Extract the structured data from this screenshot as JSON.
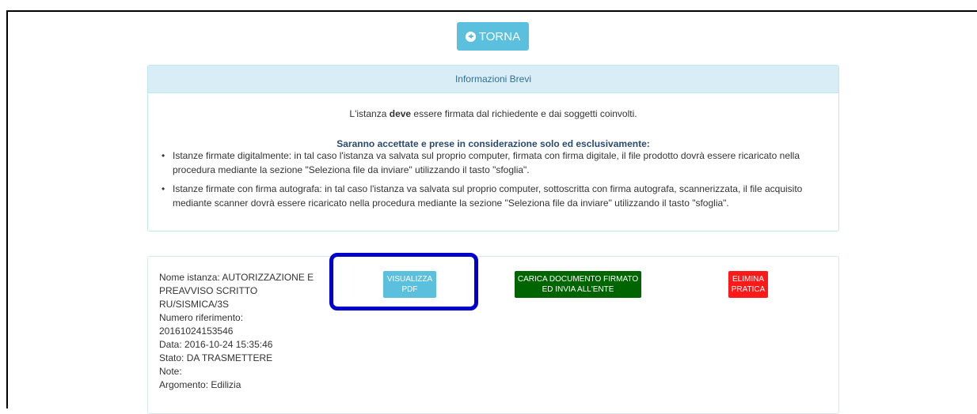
{
  "nav": {
    "back_label": "TORNA"
  },
  "info_panel": {
    "heading": "Informazioni Brevi",
    "intro_prefix": "L'istanza ",
    "intro_bold": "deve",
    "intro_suffix": " essere firmata dal richiedente e dai soggetti coinvolti.",
    "accept_title": "Saranno accettate e prese in considerazione solo ed esclusivamente:",
    "bullets": [
      "Istanze firmate digitalmente: in tal caso l'istanza va salvata sul proprio computer, firmata con firma digitale, il file prodotto dovrà essere ricaricato nella procedura mediante la sezione \"Seleziona file da inviare\" utilizzando il tasto \"sfoglia\".",
      "Istanze firmate con firma autografa: in tal caso l'istanza va salvata sul proprio computer, sottoscritta con firma autografa, scannerizzata, il file acquisito mediante scanner dovrà essere ricaricato nella procedura mediante la sezione \"Seleziona file da inviare\" utilizzando il tasto \"sfoglia\"."
    ]
  },
  "request": {
    "nome": "Nome istanza: AUTORIZZAZIONE E PREAVVISO SCRITTO RU/SISMICA/3S",
    "numero_label": "Numero riferimento:",
    "numero_value": "20161024153546",
    "data": "Data: 2016-10-24 15:35:46",
    "stato": "Stato: DA TRASMETTERE",
    "note": "Note:",
    "argomento": "Argomento: Edilizia"
  },
  "actions": {
    "visualizza_line1": "VISUALIZZA",
    "visualizza_line2": "PDF",
    "carica_line1": "CARICA DOCUMENTO FIRMATO",
    "carica_line2": "ED INVIA ALL'ENTE",
    "elimina_line1": "ELIMINA",
    "elimina_line2": "PRATICA"
  },
  "colors": {
    "info": "#5bc0de",
    "success": "#006400",
    "danger": "#ff1a1a",
    "highlight": "#0000cc"
  },
  "icons": {
    "back": "circle-arrow-left-icon"
  }
}
